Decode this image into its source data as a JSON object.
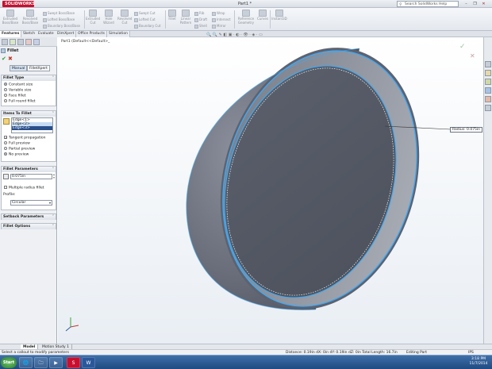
{
  "titlebar": {
    "app_name": "SOLIDWORKS",
    "doc_title": "Part1 *",
    "search_placeholder": "Search SolidWorks Help",
    "minimize": "–",
    "restore": "❐",
    "close": "✕"
  },
  "commands": {
    "extruded_boss": "Extruded Boss/Base",
    "revolved_boss": "Revolved Boss/Base",
    "swept_boss": "Swept Boss/Base",
    "lofted_boss": "Lofted Boss/Base",
    "boundary_boss": "Boundary Boss/Base",
    "extruded_cut": "Extruded Cut",
    "hole_wizard": "Hole Wizard",
    "revolved_cut": "Revolved Cut",
    "swept_cut": "Swept Cut",
    "lofted_cut": "Lofted Cut",
    "boundary_cut": "Boundary Cut",
    "fillet": "Fillet",
    "linear_pattern": "Linear Pattern",
    "rib": "Rib",
    "draft": "Draft",
    "shell": "Shell",
    "wrap": "Wrap",
    "intersect": "Intersect",
    "mirror": "Mirror",
    "reference_geometry": "Reference Geometry",
    "curves": "Curves",
    "instant3d": "Instant3D"
  },
  "tabs": [
    "Features",
    "Sketch",
    "Evaluate",
    "DimXpert",
    "Office Products",
    "Simulation"
  ],
  "panel": {
    "title": "Fillet",
    "ok": "✔",
    "cancel": "✖",
    "mode_manual": "Manual",
    "mode_xpert": "FilletXpert",
    "fillet_type": {
      "header": "Fillet Type",
      "options": [
        "Constant size",
        "Variable size",
        "Face fillet",
        "Full round fillet"
      ]
    },
    "items": {
      "header": "Items To Fillet",
      "edges": [
        "Edge<1>",
        "Edge<2>",
        "Edge<3>"
      ],
      "tangent": "Tangent propagation",
      "previews": [
        "Full preview",
        "Partial preview",
        "No preview"
      ]
    },
    "params": {
      "header": "Fillet Parameters",
      "radius": "0.075in",
      "multiple": "Multiple radius fillet",
      "profile_label": "Profile:",
      "profile_value": "Circular"
    },
    "setback": "Setback Parameters",
    "options": "Fillet Options"
  },
  "graphics": {
    "tree_label": "Part1 (Default<<Default>_",
    "radius_callout": "Radius: 0.075in",
    "view_toolbar": "🔍 🔍 ✎ ◧ ▣ · ◐ · 👁 · ◈ · ▭"
  },
  "bottom_tabs": [
    "Model",
    "Motion Study 1"
  ],
  "status": {
    "hint": "Select a callout to modify parameters",
    "measure": "Distance: 0.19in   dX: 0in   dY: 0.19in   dZ: 0in   Total Length: 16.7in",
    "mode": "Editing Part",
    "units": "IPS"
  },
  "taskbar": {
    "start": "Start",
    "time": "3:18 PM",
    "date": "11/7/2014"
  },
  "colors": {
    "accent": "#2a4f8a",
    "model": "#5d6270",
    "highlight": "#3fa9f5"
  }
}
